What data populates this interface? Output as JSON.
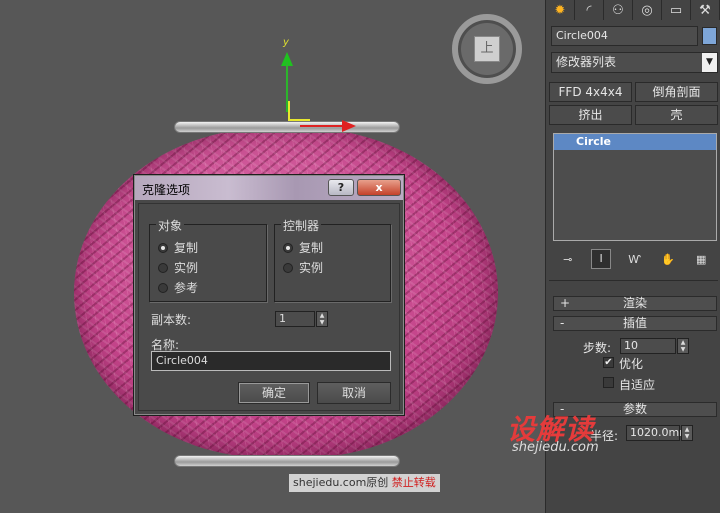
{
  "viewport": {
    "viewcube_face": "上",
    "axis_y_label": "y"
  },
  "dialog": {
    "title": "克隆选项",
    "help_label": "?",
    "close_label": "x",
    "object_group": {
      "title": "对象",
      "options": [
        {
          "label": "复制",
          "selected": true
        },
        {
          "label": "实例",
          "selected": false
        },
        {
          "label": "参考",
          "selected": false
        }
      ]
    },
    "controller_group": {
      "title": "控制器",
      "options": [
        {
          "label": "复制",
          "selected": true
        },
        {
          "label": "实例",
          "selected": false
        }
      ]
    },
    "copies_label": "副本数:",
    "copies_value": "1",
    "name_label": "名称:",
    "name_value": "Circle004",
    "ok_label": "确定",
    "cancel_label": "取消"
  },
  "panel": {
    "tabs": [
      {
        "icon": "sun-icon"
      },
      {
        "icon": "curve-icon"
      },
      {
        "icon": "hierarchy-icon"
      },
      {
        "icon": "motion-icon"
      },
      {
        "icon": "display-icon"
      },
      {
        "icon": "hammer-icon"
      }
    ],
    "object_name": "Circle004",
    "object_color": "#7ea6d8",
    "modifier_list": "修改器列表",
    "buttons": [
      "FFD 4x4x4",
      "倒角剖面",
      "挤出",
      "壳"
    ],
    "stack_items": [
      "Circle"
    ],
    "rollouts": {
      "render": {
        "sign": "+",
        "title": "渲染"
      },
      "interpolation": {
        "sign": "-",
        "title": "插值"
      },
      "parameters": {
        "sign": "-",
        "title": "参数"
      }
    },
    "steps_label": "步数:",
    "steps_value": "10",
    "optimize_label": "优化",
    "optimize_checked": true,
    "adaptive_label": "自适应",
    "adaptive_checked": false,
    "radius_label": "半径:",
    "radius_value": "1020.0mm"
  },
  "watermark": {
    "brand": "设解读",
    "url": "shejiedu.com",
    "caption_site": "shejiedu.com原创",
    "caption_warning": "禁止转载"
  }
}
